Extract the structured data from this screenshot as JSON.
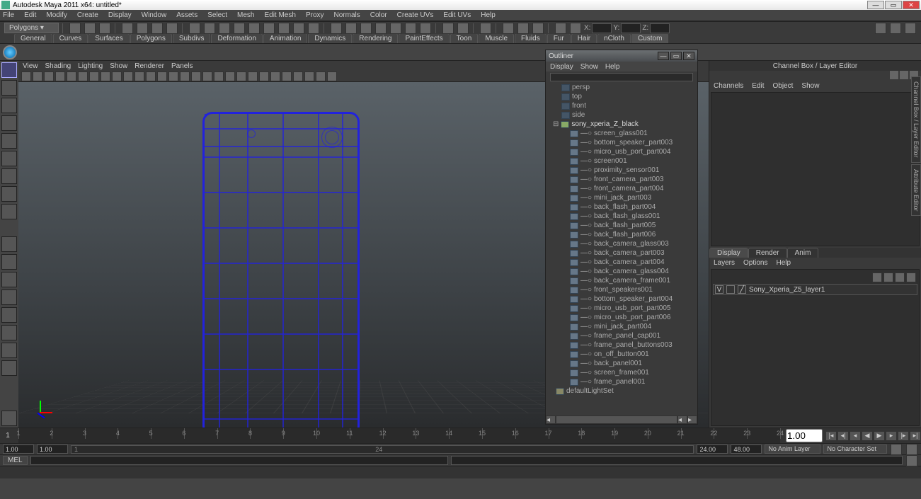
{
  "title": "Autodesk Maya 2011 x64: untitled*",
  "menubar": [
    "File",
    "Edit",
    "Modify",
    "Create",
    "Display",
    "Window",
    "Assets",
    "Select",
    "Mesh",
    "Edit Mesh",
    "Proxy",
    "Normals",
    "Color",
    "Create UVs",
    "Edit UVs",
    "Help"
  ],
  "mode_dropdown": "Polygons",
  "coord_labels": {
    "x": "X:",
    "y": "Y:",
    "z": "Z:"
  },
  "shelf_tabs": [
    "General",
    "Curves",
    "Surfaces",
    "Polygons",
    "Subdivs",
    "Deformation",
    "Animation",
    "Dynamics",
    "Rendering",
    "PaintEffects",
    "Toon",
    "Muscle",
    "Fluids",
    "Fur",
    "Hair",
    "nCloth",
    "Custom"
  ],
  "viewport_menus": [
    "View",
    "Shading",
    "Lighting",
    "Show",
    "Renderer",
    "Panels"
  ],
  "outliner": {
    "title": "Outliner",
    "menus": [
      "Display",
      "Show",
      "Help"
    ],
    "cameras": [
      "persp",
      "top",
      "front",
      "side"
    ],
    "root": "sony_xperia_Z_black",
    "children": [
      "screen_glass001",
      "bottom_speaker_part003",
      "micro_usb_port_part004",
      "screen001",
      "proximity_sensor001",
      "front_camera_part003",
      "front_camera_part004",
      "mini_jack_part003",
      "back_flash_part004",
      "back_flash_glass001",
      "back_flash_part005",
      "back_flash_part006",
      "back_camera_glass003",
      "back_camera_part003",
      "back_camera_part004",
      "back_camera_glass004",
      "back_camera_frame001",
      "front_speakers001",
      "bottom_speaker_part004",
      "micro_usb_port_part005",
      "micro_usb_port_part006",
      "mini_jack_part004",
      "frame_panel_cap001",
      "frame_panel_buttons003",
      "on_off_button001",
      "back_panel001",
      "screen_frame001",
      "frame_panel001"
    ],
    "lightset": "defaultLightSet"
  },
  "channelbox": {
    "title": "Channel Box / Layer Editor",
    "menus": [
      "Channels",
      "Edit",
      "Object",
      "Show"
    ],
    "tabs": [
      "Display",
      "Render",
      "Anim"
    ],
    "menus2": [
      "Layers",
      "Options",
      "Help"
    ],
    "layer_v": "V",
    "layer_name": "Sony_Xperia_Z5_layer1"
  },
  "side_tabs": [
    "Channel Box / Layer Editor",
    "Attribute Editor"
  ],
  "timeline": {
    "frames": [
      1,
      2,
      3,
      4,
      5,
      6,
      7,
      8,
      9,
      10,
      11,
      12,
      13,
      14,
      15,
      16,
      17,
      18,
      19,
      20,
      21,
      22,
      23,
      24
    ],
    "current": "1",
    "start_outer": "1.00",
    "start_inner": "1.00",
    "end_inner": "24.00",
    "end_outer": "48.00",
    "cur_box": "1.00",
    "slider_start": "1",
    "slider_mid": "24",
    "no_anim": "No Anim Layer",
    "no_char": "No Character Set"
  },
  "mel": "MEL"
}
